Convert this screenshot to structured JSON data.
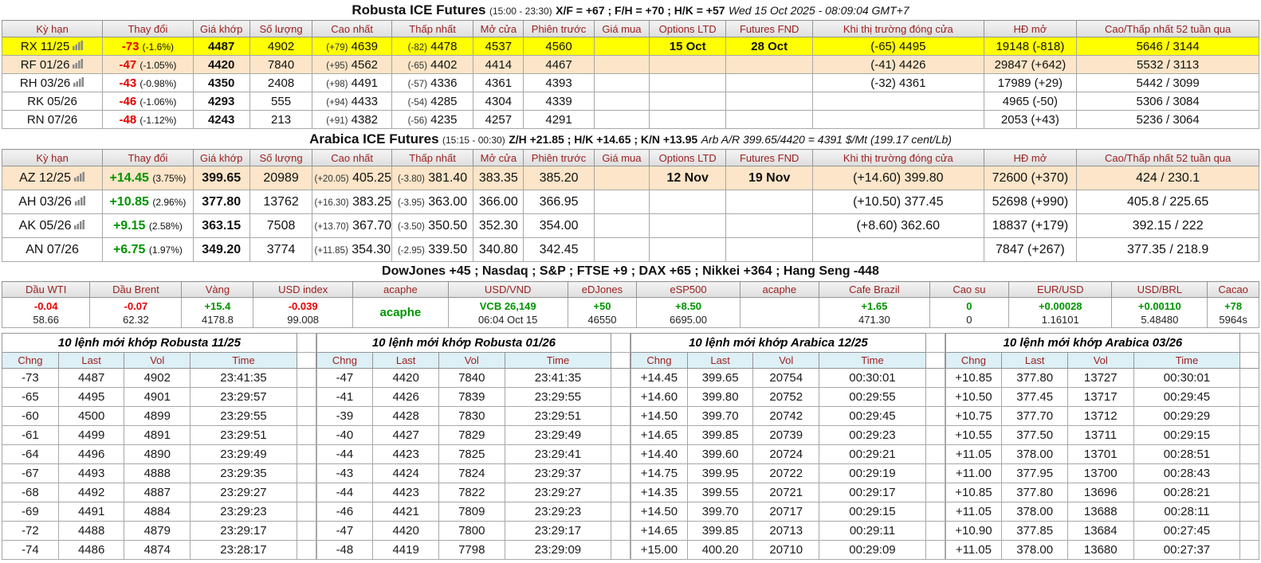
{
  "colors": {
    "accent_red": "#e60000",
    "accent_green": "#009400",
    "header_text_red": "#9c2020",
    "highlight_yellow": "#ffff00",
    "highlight_peach": "#fce5c8",
    "orderbook_header_bg": "#ddf0f6"
  },
  "robusta": {
    "title": "Robusta ICE Futures",
    "session": "(15:00 - 23:30)",
    "spreads": "X/F = +67 ; F/H = +70 ; H/K = +57",
    "datetime": "Wed 15 Oct 2025 - 08:09:04 GMT+7",
    "headers": [
      "Kỳ hạn",
      "Thay đổi",
      "Giá khớp",
      "Số lượng",
      "Cao nhất",
      "Thấp nhất",
      "Mở cửa",
      "Phiên trước",
      "Giá mua",
      "Options LTD",
      "Futures FND",
      "Khi thị trường đóng cửa",
      "HĐ mở",
      "Cao/Thấp nhất 52 tuần qua"
    ],
    "rows": [
      {
        "contract": "RX 11/25",
        "chart": true,
        "trend": "neg",
        "change": "-73",
        "pct": "(-1.6%)",
        "last": "4487",
        "vol": "4902",
        "high_chg": "(+79)",
        "high": "4639",
        "low_chg": "(-82)",
        "low": "4478",
        "open": "4537",
        "prev": "4560",
        "bid": "",
        "ltd": "15 Oct",
        "fnd": "28 Oct",
        "close": "(-65) 4495",
        "oi": "19148 (-818)",
        "w52": "5646 / 3144",
        "hl": "hl-yellow"
      },
      {
        "contract": "RF 01/26",
        "chart": true,
        "trend": "neg",
        "change": "-47",
        "pct": "(-1.05%)",
        "last": "4420",
        "vol": "7840",
        "high_chg": "(+95)",
        "high": "4562",
        "low_chg": "(-65)",
        "low": "4402",
        "open": "4414",
        "prev": "4467",
        "bid": "",
        "ltd": "",
        "fnd": "",
        "close": "(-41) 4426",
        "oi": "29847 (+642)",
        "w52": "5532 / 3113",
        "hl": "hl-peach"
      },
      {
        "contract": "RH 03/26",
        "chart": true,
        "trend": "neg",
        "change": "-43",
        "pct": "(-0.98%)",
        "last": "4350",
        "vol": "2408",
        "high_chg": "(+98)",
        "high": "4491",
        "low_chg": "(-57)",
        "low": "4336",
        "open": "4361",
        "prev": "4393",
        "bid": "",
        "ltd": "",
        "fnd": "",
        "close": "(-32) 4361",
        "oi": "17989 (+29)",
        "w52": "5442 / 3099",
        "hl": ""
      },
      {
        "contract": "RK 05/26",
        "chart": false,
        "trend": "neg",
        "change": "-46",
        "pct": "(-1.06%)",
        "last": "4293",
        "vol": "555",
        "high_chg": "(+94)",
        "high": "4433",
        "low_chg": "(-54)",
        "low": "4285",
        "open": "4304",
        "prev": "4339",
        "bid": "",
        "ltd": "",
        "fnd": "",
        "close": "",
        "oi": "4965 (-50)",
        "w52": "5306 / 3084",
        "hl": ""
      },
      {
        "contract": "RN 07/26",
        "chart": false,
        "trend": "neg",
        "change": "-48",
        "pct": "(-1.12%)",
        "last": "4243",
        "vol": "213",
        "high_chg": "(+91)",
        "high": "4382",
        "low_chg": "(-56)",
        "low": "4235",
        "open": "4257",
        "prev": "4291",
        "bid": "",
        "ltd": "",
        "fnd": "",
        "close": "",
        "oi": "2053 (+43)",
        "w52": "5236 / 3064",
        "hl": ""
      }
    ]
  },
  "arabica": {
    "title": "Arabica ICE Futures",
    "session": "(15:15 - 00:30)",
    "spreads": "Z/H +21.85 ; H/K +14.65 ; K/N +13.95",
    "arb": "Arb A/R 399.65/4420 = 4391 $/Mt (199.17 cent/Lb)",
    "headers": [
      "Kỳ hạn",
      "Thay đổi",
      "Giá khớp",
      "Số lượng",
      "Cao nhất",
      "Thấp nhất",
      "Mở cửa",
      "Phiên trước",
      "Giá mua",
      "Options LTD",
      "Futures FND",
      "Khi thị trường đóng cửa",
      "HĐ mở",
      "Cao/Thấp nhất 52 tuần qua"
    ],
    "rows": [
      {
        "contract": "AZ 12/25",
        "chart": true,
        "trend": "pos",
        "change": "+14.45",
        "pct": "(3.75%)",
        "last": "399.65",
        "vol": "20989",
        "high_chg": "(+20.05)",
        "high": "405.25",
        "low_chg": "(-3.80)",
        "low": "381.40",
        "open": "383.35",
        "prev": "385.20",
        "bid": "",
        "ltd": "12 Nov",
        "fnd": "19 Nov",
        "close": "(+14.60) 399.80",
        "oi": "72600 (+370)",
        "w52": "424 / 230.1",
        "hl": "hl-peach"
      },
      {
        "contract": "AH 03/26",
        "chart": true,
        "trend": "pos",
        "change": "+10.85",
        "pct": "(2.96%)",
        "last": "377.80",
        "vol": "13762",
        "high_chg": "(+16.30)",
        "high": "383.25",
        "low_chg": "(-3.95)",
        "low": "363.00",
        "open": "366.00",
        "prev": "366.95",
        "bid": "",
        "ltd": "",
        "fnd": "",
        "close": "(+10.50) 377.45",
        "oi": "52698 (+990)",
        "w52": "405.8 / 225.65",
        "hl": ""
      },
      {
        "contract": "AK 05/26",
        "chart": true,
        "trend": "pos",
        "change": "+9.15",
        "pct": "(2.58%)",
        "last": "363.15",
        "vol": "7508",
        "high_chg": "(+13.70)",
        "high": "367.70",
        "low_chg": "(-3.50)",
        "low": "350.50",
        "open": "352.30",
        "prev": "354.00",
        "bid": "",
        "ltd": "",
        "fnd": "",
        "close": "(+8.60) 362.60",
        "oi": "18837 (+179)",
        "w52": "392.15 / 222",
        "hl": ""
      },
      {
        "contract": "AN 07/26",
        "chart": false,
        "trend": "pos",
        "change": "+6.75",
        "pct": "(1.97%)",
        "last": "349.20",
        "vol": "3774",
        "high_chg": "(+11.85)",
        "high": "354.30",
        "low_chg": "(-2.95)",
        "low": "339.50",
        "open": "340.80",
        "prev": "342.45",
        "bid": "",
        "ltd": "",
        "fnd": "",
        "close": "",
        "oi": "7847 (+267)",
        "w52": "377.35 / 218.9",
        "hl": ""
      }
    ]
  },
  "markets_line": "DowJones +45 ; Nasdaq ; S&P ; FTSE +9 ; DAX +65 ; Nikkei +364 ; Hang Seng -448",
  "indices": {
    "columns": [
      {
        "label": "Dầu WTI",
        "change": "-0.04",
        "trend": "neg",
        "value": "58.66"
      },
      {
        "label": "Dầu Brent",
        "change": "-0.07",
        "trend": "neg",
        "value": "62.32"
      },
      {
        "label": "Vàng",
        "change": "+15.4",
        "trend": "pos",
        "value": "4178.8"
      },
      {
        "label": "USD index",
        "change": "-0.039",
        "trend": "neg",
        "value": "99.008"
      },
      {
        "label": "acaphe",
        "change": "acaphe",
        "trend": "pos brand",
        "value": ""
      },
      {
        "label": "USD/VND",
        "change": "VCB 26,149",
        "trend": "pos",
        "value": "06:04 Oct 15"
      },
      {
        "label": "eDJones",
        "change": "+50",
        "trend": "pos",
        "value": "46550"
      },
      {
        "label": "eSP500",
        "change": "+8.50",
        "trend": "pos",
        "value": "6695.00"
      },
      {
        "label": "acaphe",
        "change": "",
        "trend": "",
        "value": ""
      },
      {
        "label": "Cafe Brazil",
        "change": "+1.65",
        "trend": "pos",
        "value": "471.30"
      },
      {
        "label": "Cao su",
        "change": "0",
        "trend": "pos",
        "value": "0"
      },
      {
        "label": "EUR/USD",
        "change": "+0.00028",
        "trend": "pos",
        "value": "1.16101"
      },
      {
        "label": "USD/BRL",
        "change": "+0.00110",
        "trend": "pos",
        "value": "5.48480"
      },
      {
        "label": "Cacao",
        "change": "+78",
        "trend": "pos",
        "value": "5964s"
      }
    ]
  },
  "orderbooks": [
    {
      "title": "10 lệnh mới khớp Robusta 11/25",
      "headers": [
        "Chng",
        "Last",
        "Vol",
        "Time"
      ],
      "rows": [
        {
          "chng": "-73",
          "last": "4487",
          "vol": "4902",
          "time": "23:41:35"
        },
        {
          "chng": "-65",
          "last": "4495",
          "vol": "4901",
          "time": "23:29:57"
        },
        {
          "chng": "-60",
          "last": "4500",
          "vol": "4899",
          "time": "23:29:55"
        },
        {
          "chng": "-61",
          "last": "4499",
          "vol": "4891",
          "time": "23:29:51"
        },
        {
          "chng": "-64",
          "last": "4496",
          "vol": "4890",
          "time": "23:29:49"
        },
        {
          "chng": "-67",
          "last": "4493",
          "vol": "4888",
          "time": "23:29:35"
        },
        {
          "chng": "-68",
          "last": "4492",
          "vol": "4887",
          "time": "23:29:27"
        },
        {
          "chng": "-69",
          "last": "4491",
          "vol": "4884",
          "time": "23:29:23"
        },
        {
          "chng": "-72",
          "last": "4488",
          "vol": "4879",
          "time": "23:29:17"
        },
        {
          "chng": "-74",
          "last": "4486",
          "vol": "4874",
          "time": "23:28:17"
        }
      ]
    },
    {
      "title": "10 lệnh mới khớp Robusta 01/26",
      "headers": [
        "Chng",
        "Last",
        "Vol",
        "Time"
      ],
      "rows": [
        {
          "chng": "-47",
          "last": "4420",
          "vol": "7840",
          "time": "23:41:35"
        },
        {
          "chng": "-41",
          "last": "4426",
          "vol": "7839",
          "time": "23:29:55"
        },
        {
          "chng": "-39",
          "last": "4428",
          "vol": "7830",
          "time": "23:29:51"
        },
        {
          "chng": "-40",
          "last": "4427",
          "vol": "7829",
          "time": "23:29:49"
        },
        {
          "chng": "-44",
          "last": "4423",
          "vol": "7825",
          "time": "23:29:41"
        },
        {
          "chng": "-43",
          "last": "4424",
          "vol": "7824",
          "time": "23:29:37"
        },
        {
          "chng": "-44",
          "last": "4423",
          "vol": "7822",
          "time": "23:29:27"
        },
        {
          "chng": "-46",
          "last": "4421",
          "vol": "7809",
          "time": "23:29:23"
        },
        {
          "chng": "-47",
          "last": "4420",
          "vol": "7800",
          "time": "23:29:17"
        },
        {
          "chng": "-48",
          "last": "4419",
          "vol": "7798",
          "time": "23:29:09"
        }
      ]
    },
    {
      "title": "10 lệnh mới khớp Arabica 12/25",
      "headers": [
        "Chng",
        "Last",
        "Vol",
        "Time"
      ],
      "rows": [
        {
          "chng": "+14.45",
          "last": "399.65",
          "vol": "20754",
          "time": "00:30:01"
        },
        {
          "chng": "+14.60",
          "last": "399.80",
          "vol": "20752",
          "time": "00:29:55"
        },
        {
          "chng": "+14.50",
          "last": "399.70",
          "vol": "20742",
          "time": "00:29:45"
        },
        {
          "chng": "+14.65",
          "last": "399.85",
          "vol": "20739",
          "time": "00:29:23"
        },
        {
          "chng": "+14.40",
          "last": "399.60",
          "vol": "20724",
          "time": "00:29:21"
        },
        {
          "chng": "+14.75",
          "last": "399.95",
          "vol": "20722",
          "time": "00:29:19"
        },
        {
          "chng": "+14.35",
          "last": "399.55",
          "vol": "20721",
          "time": "00:29:17"
        },
        {
          "chng": "+14.50",
          "last": "399.70",
          "vol": "20717",
          "time": "00:29:15"
        },
        {
          "chng": "+14.65",
          "last": "399.85",
          "vol": "20713",
          "time": "00:29:11"
        },
        {
          "chng": "+15.00",
          "last": "400.20",
          "vol": "20710",
          "time": "00:29:09"
        }
      ]
    },
    {
      "title": "10 lệnh mới khớp Arabica 03/26",
      "headers": [
        "Chng",
        "Last",
        "Vol",
        "Time"
      ],
      "rows": [
        {
          "chng": "+10.85",
          "last": "377.80",
          "vol": "13727",
          "time": "00:30:01"
        },
        {
          "chng": "+10.50",
          "last": "377.45",
          "vol": "13717",
          "time": "00:29:45"
        },
        {
          "chng": "+10.75",
          "last": "377.70",
          "vol": "13712",
          "time": "00:29:29"
        },
        {
          "chng": "+10.55",
          "last": "377.50",
          "vol": "13711",
          "time": "00:29:15"
        },
        {
          "chng": "+11.05",
          "last": "378.00",
          "vol": "13701",
          "time": "00:28:51"
        },
        {
          "chng": "+11.00",
          "last": "377.95",
          "vol": "13700",
          "time": "00:28:43"
        },
        {
          "chng": "+10.85",
          "last": "377.80",
          "vol": "13696",
          "time": "00:28:21"
        },
        {
          "chng": "+11.05",
          "last": "378.00",
          "vol": "13688",
          "time": "00:28:11"
        },
        {
          "chng": "+10.90",
          "last": "377.85",
          "vol": "13684",
          "time": "00:27:45"
        },
        {
          "chng": "+11.05",
          "last": "378.00",
          "vol": "13680",
          "time": "00:27:37"
        }
      ]
    }
  ]
}
